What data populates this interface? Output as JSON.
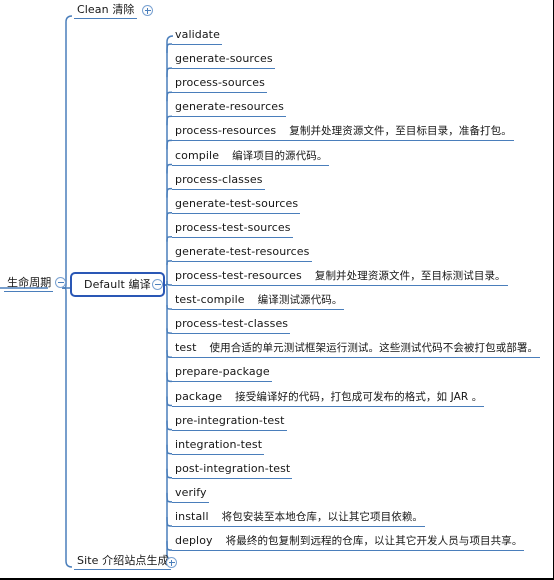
{
  "diagram": {
    "type": "mind-map",
    "root": {
      "label": "生命周期",
      "toggle": "collapse-icon"
    },
    "branches": [
      {
        "id": "clean",
        "label": "Clean  清除",
        "toggle": "expand-icon",
        "expanded": false,
        "children": []
      },
      {
        "id": "default",
        "label": "Default  编译",
        "toggle": "collapse-icon",
        "selected": true,
        "expanded": true,
        "children": [
          {
            "name": "validate",
            "desc": ""
          },
          {
            "name": "generate-sources",
            "desc": ""
          },
          {
            "name": "process-sources",
            "desc": ""
          },
          {
            "name": "generate-resources",
            "desc": ""
          },
          {
            "name": "process-resources",
            "desc": "复制并处理资源文件，至目标目录，准备打包。"
          },
          {
            "name": "compile",
            "desc": "编译项目的源代码。"
          },
          {
            "name": "process-classes",
            "desc": ""
          },
          {
            "name": "generate-test-sources",
            "desc": ""
          },
          {
            "name": "process-test-sources",
            "desc": ""
          },
          {
            "name": "generate-test-resources",
            "desc": ""
          },
          {
            "name": "process-test-resources",
            "desc": "复制并处理资源文件，至目标测试目录。"
          },
          {
            "name": "test-compile",
            "desc": "编译测试源代码。"
          },
          {
            "name": "process-test-classes",
            "desc": ""
          },
          {
            "name": "test",
            "desc": "使用合适的单元测试框架运行测试。这些测试代码不会被打包或部署。"
          },
          {
            "name": "prepare-package",
            "desc": ""
          },
          {
            "name": "package",
            "desc": "接受编译好的代码，打包成可发布的格式，如 JAR 。"
          },
          {
            "name": "pre-integration-test",
            "desc": ""
          },
          {
            "name": "integration-test",
            "desc": ""
          },
          {
            "name": "post-integration-test",
            "desc": ""
          },
          {
            "name": "verify",
            "desc": ""
          },
          {
            "name": "install",
            "desc": "将包安装至本地仓库，以让其它项目依赖。"
          },
          {
            "name": "deploy",
            "desc": "将最终的包复制到远程的仓库，以让其它开发人员与项目共享。"
          }
        ]
      },
      {
        "id": "site",
        "label": "Site 介绍站点生成",
        "toggle": "expand-icon",
        "expanded": false,
        "children": []
      }
    ],
    "colors": {
      "line": "#4a7ebb",
      "selected_border": "#2a57b5",
      "text": "#1b1b1b",
      "background": "#ffffff"
    }
  }
}
